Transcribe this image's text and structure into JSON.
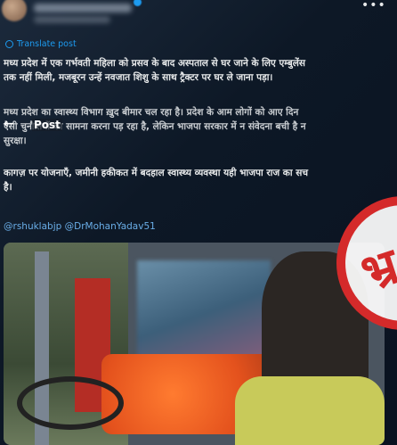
{
  "post": {
    "translate_label": "Translate post",
    "more_label": "•••",
    "paragraph1": "मध्य प्रदेश में एक गर्भवती महिला को प्रसव के बाद अस्पताल से घर जाने के लिए एम्बुलेंस\nतक नहीं मिली, मजबूरन उन्हें नवजात शिशु के साथ ट्रैक्टर पर घर ले जाना पड़ा।",
    "paragraph2": "मध्य प्रदेश का स्वास्थ्य विभाग ख़ुद बीमार चल रहा है। प्रदेश के आम लोगों को आए दिन\nऐसी चुनौतियों का सामना करना पड़ रहा है, लेकिन भाजपा सरकार में न संवेदना बची है न\nसुरक्षा।",
    "paragraph3": "कागज़ पर योजनाएँ, जमीनी हकीकत में बदहाल स्वास्थ्य व्यवस्था यही भाजपा राज का सच\nहै।",
    "mentions": "@rshuklabjp @DrMohanYadav51"
  },
  "overlay": {
    "back_label": "←",
    "title": "Post"
  },
  "stamp": {
    "text": "भ्र"
  }
}
